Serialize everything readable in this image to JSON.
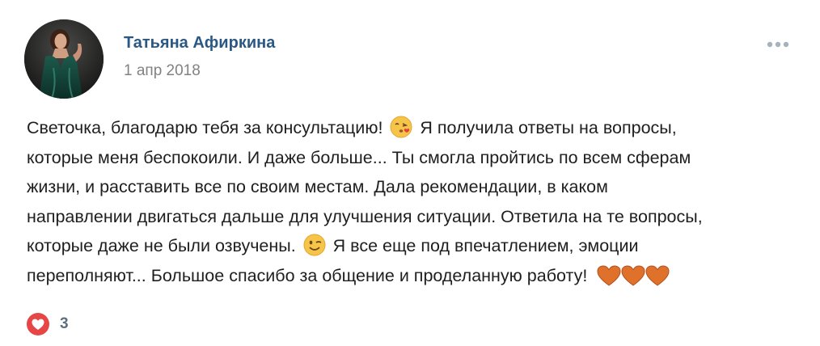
{
  "post": {
    "author": "Татьяна Афиркина",
    "date": "1 апр 2018",
    "text_lines": [
      {
        "before": "Светочка, благодарю тебя за консультацию!",
        "emoji": "kissing-face-emoji",
        "after": "Я получила ответы на вопросы,"
      },
      {
        "before": "которые меня беспокоили. И даже больше... Ты смогла пройтись по всем сферам"
      },
      {
        "before": "жизни, и расставить все по своим местам. Дала рекомендации, в каком"
      },
      {
        "before": "направлении двигаться дальше для улучшения ситуации. Ответила на те вопросы,"
      },
      {
        "before": "которые даже не были озвучены.",
        "emoji": "winking-face-emoji",
        "after": "Я все еще под впечатлением, эмоции"
      },
      {
        "before": "переполняют... Большое спасибо за общение и проделанную работу!",
        "trailing_emojis": [
          "orange-heart-emoji",
          "orange-heart-emoji",
          "orange-heart-emoji"
        ]
      }
    ],
    "likes_count": "3"
  },
  "icons": {
    "more": "more-horizontal-icon",
    "like": "heart-icon"
  },
  "colors": {
    "author_link": "#2a5885",
    "date": "#828282",
    "text": "#1f1f1f",
    "like_red": "#e64646",
    "like_count": "#5e6f80",
    "heart_orange": "#e0712a"
  }
}
